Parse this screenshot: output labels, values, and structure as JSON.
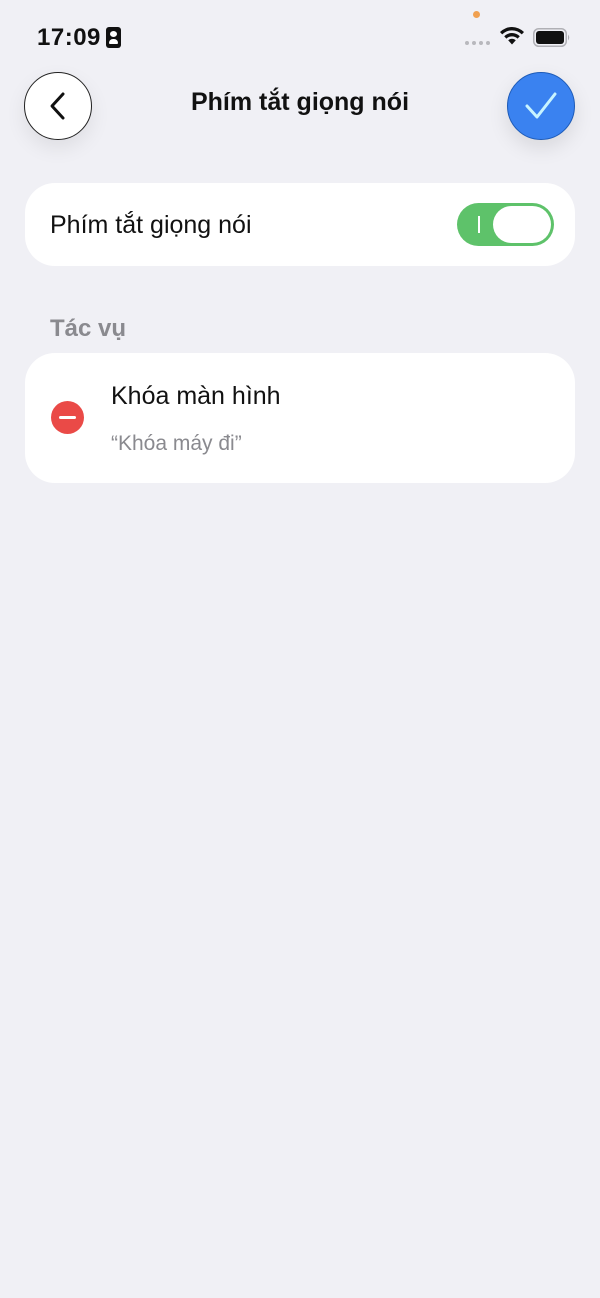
{
  "status_bar": {
    "time": "17:09",
    "icons": [
      "contact-card-icon",
      "signal-dots-icon",
      "wifi-icon",
      "battery-icon"
    ]
  },
  "nav": {
    "title": "Phím tắt giọng nói",
    "back_icon": "chevron-left-icon",
    "confirm_icon": "checkmark-icon"
  },
  "toggle_card": {
    "label": "Phím tắt giọng nói",
    "enabled": true
  },
  "section": {
    "title": "Tác vụ"
  },
  "tasks": [
    {
      "title": "Khóa màn hình",
      "phrase": "“Khóa máy đi”",
      "action_icon": "remove-circle-icon"
    }
  ],
  "colors": {
    "background": "#f0f0f5",
    "accent_blue": "#3a82f0",
    "toggle_green": "#5ec26a",
    "remove_red": "#ea4a47",
    "secondary_text": "#8a8a8f"
  }
}
